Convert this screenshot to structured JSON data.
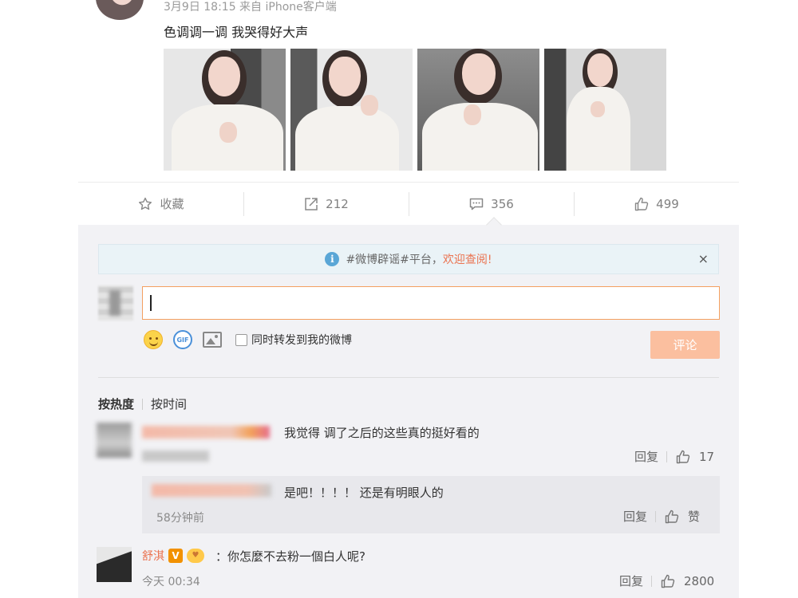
{
  "post": {
    "meta": "3月9日 18:15 来自 iPhone客户端",
    "text": "色调调一调 我哭得好大声"
  },
  "actions": {
    "favorite_label": "收藏",
    "repost_count": "212",
    "comment_count": "356",
    "like_count": "499"
  },
  "notice": {
    "prefix": "#微博辟谣#平台，",
    "link": "欢迎查阅!",
    "close": "×"
  },
  "composer": {
    "input_value": "",
    "gif_label": "GIF",
    "repost_checkbox_label": "同时转发到我的微博",
    "submit_label": "评论"
  },
  "sort": {
    "by_hot": "按热度",
    "by_time": "按时间"
  },
  "comments": [
    {
      "text": "我觉得 调了之后的这些真的挺好看的",
      "reply_label": "回复",
      "likes": "17"
    },
    {
      "text": "是吧！！！！ 还是有明眼人的",
      "time": "58分钟前",
      "reply_label": "回复",
      "likes": "赞"
    },
    {
      "name": "舒淇",
      "verified": "V",
      "text": "：你怎麼不去粉一個白人呢?",
      "time": "今天 00:34",
      "reply_label": "回复",
      "likes": "2800"
    }
  ]
}
